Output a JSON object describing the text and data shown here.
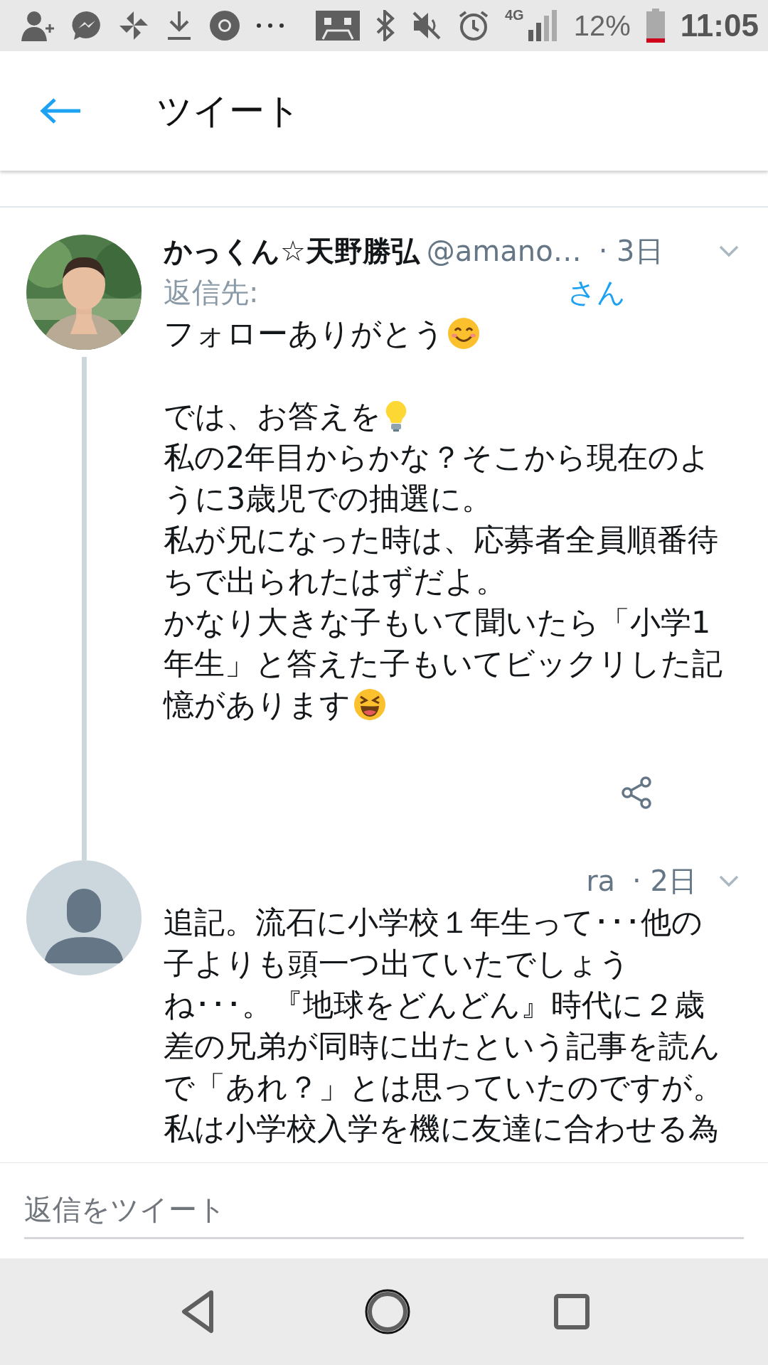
{
  "status_bar": {
    "network": "4G",
    "battery": "12%",
    "time": "11:05"
  },
  "header": {
    "title": "ツイート"
  },
  "tweets": [
    {
      "name": "かっくん☆天野勝弘",
      "handle": "@amano…",
      "time": "· 3日",
      "kind": "picture",
      "thread": true,
      "share": true,
      "reply_to": {
        "label": "返信先:",
        "suffix": "さん"
      },
      "lines": [
        {
          "kind": "smile",
          "text": "フォローありがとう"
        },
        {
          "kind": "blank"
        },
        {
          "kind": "bulb",
          "text": "では、お答えを"
        },
        {
          "kind": "plain",
          "text": "私の2年目からかな？そこから現在のよ"
        },
        {
          "kind": "plain",
          "text": "うに3歳児での抽選に。"
        },
        {
          "kind": "plain",
          "text": "私が兄になった時は、応募者全員順番待"
        },
        {
          "kind": "plain",
          "text": "ちで出られたはずだよ。"
        },
        {
          "kind": "plain",
          "text": "かなり大きな子もいて聞いたら「小学1"
        },
        {
          "kind": "plain",
          "text": "年生」と答えた子もいてビックリした記"
        },
        {
          "kind": "laugh",
          "text": "憶があります"
        }
      ]
    },
    {
      "handle": "ra",
      "time": "· 2日",
      "kind": "default",
      "thread": false,
      "share": false,
      "lines": [
        {
          "kind": "plain",
          "text": "追記。流石に小学校１年生って･･･他の"
        },
        {
          "kind": "plain",
          "text": "子よりも頭一つ出ていたでしょう"
        },
        {
          "kind": "plain",
          "text": "ね･･･。『地球をどんどん』時代に２歳"
        },
        {
          "kind": "plain",
          "text": "差の兄弟が同時に出たという記事を読ん"
        },
        {
          "kind": "plain",
          "text": "で「あれ？」とは思っていたのですが。"
        },
        {
          "kind": "plain",
          "text": "私は小学校入学を機に友達に合わせる為"
        }
      ]
    }
  ],
  "reply": {
    "placeholder": "返信をツイート"
  }
}
